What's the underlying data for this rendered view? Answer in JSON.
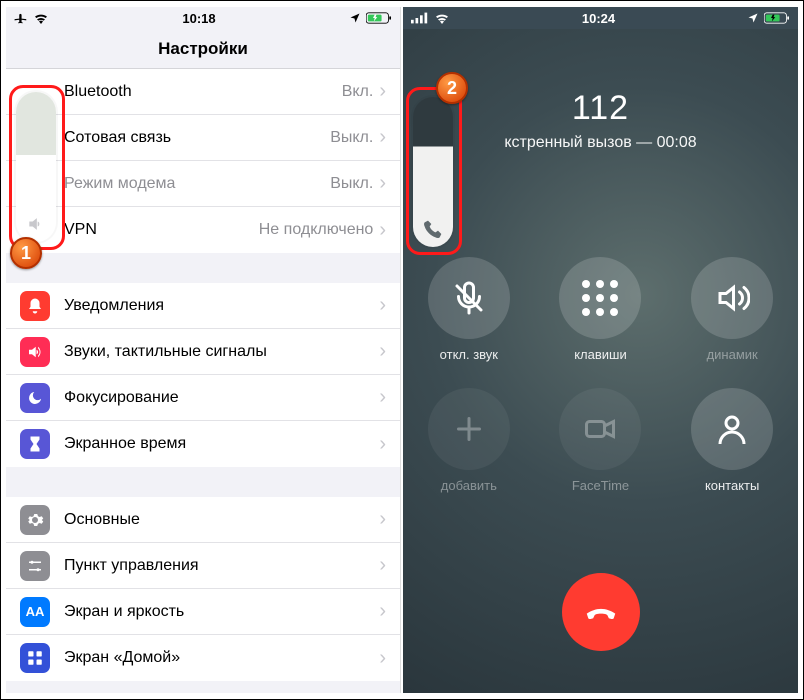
{
  "left": {
    "status": {
      "time": "10:18"
    },
    "title": "Настройки",
    "group1": [
      {
        "label": "Bluetooth",
        "value": "Вкл."
      },
      {
        "label": "Сотовая связь",
        "value": "Выкл."
      },
      {
        "label": "Режим модема",
        "value": "Выкл."
      },
      {
        "label": "VPN",
        "value": "Не подключено"
      }
    ],
    "group2": [
      {
        "label": "Уведомления",
        "icon": "bell",
        "bg": "#ff3b30"
      },
      {
        "label": "Звуки, тактильные сигналы",
        "icon": "speaker",
        "bg": "#ff2d55"
      },
      {
        "label": "Фокусирование",
        "icon": "moon",
        "bg": "#5856d6"
      },
      {
        "label": "Экранное время",
        "icon": "hourglass",
        "bg": "#5856d6"
      }
    ],
    "group3": [
      {
        "label": "Основные",
        "icon": "gear",
        "bg": "#8e8e93"
      },
      {
        "label": "Пункт управления",
        "icon": "sliders",
        "bg": "#8e8e93"
      },
      {
        "label": "Экран и яркость",
        "icon": "AA",
        "bg": "#007aff"
      },
      {
        "label": "Экран «Домой»",
        "icon": "grid",
        "bg": "#3351d8"
      }
    ],
    "badge": "1"
  },
  "right": {
    "status": {
      "time": "10:24"
    },
    "call": {
      "number": "112",
      "subtitle_prefix": "кстренный вызов —",
      "duration": "00:08"
    },
    "buttons": {
      "mute": "откл. звук",
      "keypad": "клавиши",
      "speaker": "динамик",
      "add": "добавить",
      "facetime": "FaceTime",
      "contacts": "контакты"
    },
    "badge": "2"
  }
}
